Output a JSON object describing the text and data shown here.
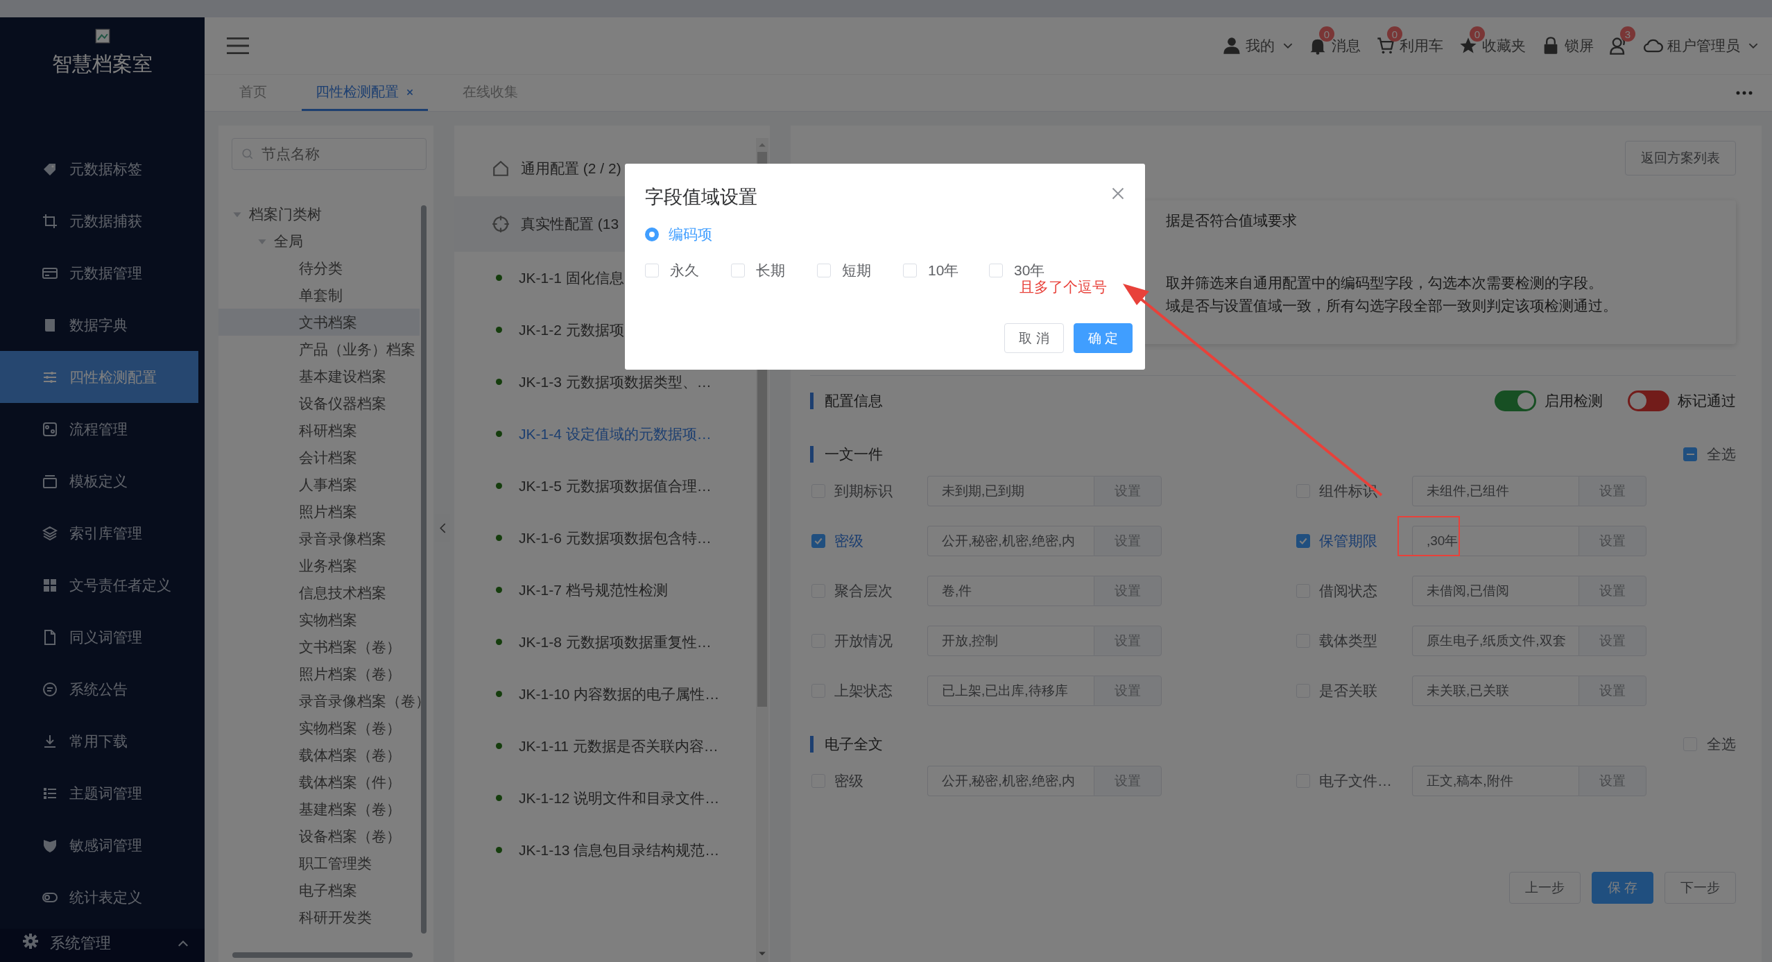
{
  "app": {
    "title": "智慧档案室"
  },
  "sidebar": {
    "items": [
      {
        "label": "元数据标签",
        "kind": "tag",
        "selected": false
      },
      {
        "label": "元数据捕获",
        "kind": "crop",
        "selected": false
      },
      {
        "label": "元数据管理",
        "kind": "card",
        "selected": false
      },
      {
        "label": "数据字典",
        "kind": "book",
        "selected": false
      },
      {
        "label": "四性检测配置",
        "kind": "sliders",
        "selected": true
      },
      {
        "label": "流程管理",
        "kind": "flow",
        "selected": false
      },
      {
        "label": "模板定义",
        "kind": "window",
        "selected": false
      },
      {
        "label": "索引库管理",
        "kind": "layers",
        "selected": false
      },
      {
        "label": "文号责任者定义",
        "kind": "grid",
        "selected": false
      },
      {
        "label": "同义词管理",
        "kind": "file",
        "selected": false
      },
      {
        "label": "系统公告",
        "kind": "chat",
        "selected": false
      },
      {
        "label": "常用下载",
        "kind": "download",
        "selected": false
      },
      {
        "label": "主题词管理",
        "kind": "list",
        "selected": false
      },
      {
        "label": "敏感词管理",
        "kind": "shield",
        "selected": false
      },
      {
        "label": "统计表定义",
        "kind": "toggle",
        "selected": false
      }
    ],
    "footer": {
      "label": "系统管理",
      "expanded": false
    }
  },
  "header": {
    "actions": [
      {
        "kind": "user",
        "label": "我的",
        "caret": true
      },
      {
        "kind": "bell",
        "badge": "0",
        "label": "消息"
      },
      {
        "kind": "cart",
        "badge": "0",
        "label": "利用车"
      },
      {
        "kind": "star",
        "badge": "0",
        "label": "收藏夹"
      },
      {
        "kind": "lock",
        "label": "锁屏"
      },
      {
        "kind": "users",
        "badge": "3"
      },
      {
        "kind": "cloud",
        "label": "租户管理员",
        "caret": true
      }
    ]
  },
  "tabs": [
    {
      "label": "首页",
      "selected": false,
      "closable": false
    },
    {
      "label": "四性检测配置",
      "selected": true,
      "closable": true
    },
    {
      "label": "在线收集",
      "selected": false,
      "closable": false
    }
  ],
  "tree": {
    "search": {
      "placeholder": "节点名称"
    },
    "nodes": [
      {
        "label": "档案门类树",
        "expanded": true,
        "children": [
          {
            "label": "全局",
            "expanded": true,
            "children": [
              {
                "label": "待分类",
                "selected": false
              },
              {
                "label": "单套制",
                "selected": false
              },
              {
                "label": "文书档案",
                "selected": true
              },
              {
                "label": "产品（业务）档案",
                "selected": false
              },
              {
                "label": "基本建设档案",
                "selected": false
              },
              {
                "label": "设备仪器档案",
                "selected": false
              },
              {
                "label": "科研档案",
                "selected": false
              },
              {
                "label": "会计档案",
                "selected": false
              },
              {
                "label": "人事档案",
                "selected": false
              },
              {
                "label": "照片档案",
                "selected": false
              },
              {
                "label": "录音录像档案",
                "selected": false
              },
              {
                "label": "业务档案",
                "selected": false
              },
              {
                "label": "信息技术档案",
                "selected": false
              },
              {
                "label": "实物档案",
                "selected": false
              },
              {
                "label": "文书档案（卷）",
                "selected": false
              },
              {
                "label": "照片档案（卷）",
                "selected": false
              },
              {
                "label": "录音录像档案（卷）",
                "selected": false
              },
              {
                "label": "实物档案（卷）",
                "selected": false
              },
              {
                "label": "载体档案（卷）",
                "selected": false
              },
              {
                "label": "载体档案（件）",
                "selected": false
              },
              {
                "label": "基建档案（卷）",
                "selected": false
              },
              {
                "label": "设备档案（卷）",
                "selected": false
              },
              {
                "label": "职工管理类",
                "selected": false
              },
              {
                "label": "电子档案",
                "selected": false
              },
              {
                "label": "科研开发类",
                "selected": false
              }
            ]
          }
        ]
      }
    ]
  },
  "rules": {
    "groups": [
      {
        "label": "通用配置 (2 / 2)",
        "kind": "home",
        "selected": false
      },
      {
        "label": "真实性配置 (13",
        "kind": "target",
        "selected": true
      }
    ],
    "items": [
      {
        "label": "JK-1-1 固化信息",
        "selected": false
      },
      {
        "label": "JK-1-2 元数据项",
        "selected": false
      },
      {
        "label": "JK-1-3 元数据项数据类型、…",
        "selected": false
      },
      {
        "label": "JK-1-4 设定值域的元数据项…",
        "selected": true
      },
      {
        "label": "JK-1-5 元数据项数据值合理…",
        "selected": false
      },
      {
        "label": "JK-1-6 元数据项数据包含特…",
        "selected": false
      },
      {
        "label": "JK-1-7 档号规范性检测",
        "selected": false
      },
      {
        "label": "JK-1-8 元数据项数据重复性…",
        "selected": false
      },
      {
        "label": "JK-1-10 内容数据的电子属性…",
        "selected": false
      },
      {
        "label": "JK-1-11 元数据是否关联内容…",
        "selected": false
      },
      {
        "label": "JK-1-12 说明文件和目录文件…",
        "selected": false
      },
      {
        "label": "JK-1-13 信息包目录结构规范…",
        "selected": false
      }
    ]
  },
  "detail": {
    "back_button": "返回方案列表",
    "description": [
      "据是否符合值域要求",
      "取并筛选来自通用配置中的编码型字段，勾选本次需要检测的字段。",
      "域是否与设置值域一致，所有勾选字段全部一致则判定该项检测通过。"
    ],
    "config_title": "配置信息",
    "switches": [
      {
        "label": "启用检测",
        "on": true
      },
      {
        "label": "标记通过",
        "on": false
      }
    ],
    "sections": [
      {
        "title": "一文一件",
        "select_all": {
          "label": "全选",
          "indeterminate": true
        },
        "fields": [
          {
            "label": "到期标识",
            "checked": false,
            "value": "未到期,已到期",
            "button": "设置"
          },
          {
            "label": "组件标识",
            "checked": false,
            "value": "未组件,已组件",
            "button": "设置"
          },
          {
            "label": "密级",
            "checked": true,
            "value": "公开,秘密,机密,绝密,内",
            "button": "设置"
          },
          {
            "label": "保管期限",
            "checked": true,
            "value": ",30年",
            "button": "设置",
            "highlighted": true
          },
          {
            "label": "聚合层次",
            "checked": false,
            "value": "卷,件",
            "button": "设置"
          },
          {
            "label": "借阅状态",
            "checked": false,
            "value": "未借阅,已借阅",
            "button": "设置"
          },
          {
            "label": "开放情况",
            "checked": false,
            "value": "开放,控制",
            "button": "设置"
          },
          {
            "label": "载体类型",
            "checked": false,
            "value": "原生电子,纸质文件,双套",
            "button": "设置"
          },
          {
            "label": "上架状态",
            "checked": false,
            "value": "已上架,已出库,待移库",
            "button": "设置"
          },
          {
            "label": "是否关联",
            "checked": false,
            "value": "未关联,已关联",
            "button": "设置"
          }
        ]
      },
      {
        "title": "电子全文",
        "select_all": {
          "label": "全选",
          "indeterminate": false
        },
        "fields": [
          {
            "label": "密级",
            "checked": false,
            "value": "公开,秘密,机密,绝密,内",
            "button": "设置"
          },
          {
            "label": "电子文件…",
            "checked": false,
            "value": "正文,稿本,附件",
            "button": "设置"
          }
        ]
      }
    ],
    "buttons": [
      {
        "label": "上一步",
        "kind": "default"
      },
      {
        "label": "保 存",
        "kind": "primary"
      },
      {
        "label": "下一步",
        "kind": "default"
      }
    ]
  },
  "modal": {
    "title": "字段值域设置",
    "radio": {
      "label": "编码项",
      "selected": true
    },
    "options": [
      {
        "label": "永久",
        "checked": false
      },
      {
        "label": "长期",
        "checked": false
      },
      {
        "label": "短期",
        "checked": false
      },
      {
        "label": "10年",
        "checked": false
      },
      {
        "label": "30年",
        "checked": false
      }
    ],
    "buttons": [
      {
        "label": "取 消",
        "kind": "default"
      },
      {
        "label": "确 定",
        "kind": "primary"
      }
    ]
  },
  "annotation": {
    "note": "且多了个逗号"
  }
}
